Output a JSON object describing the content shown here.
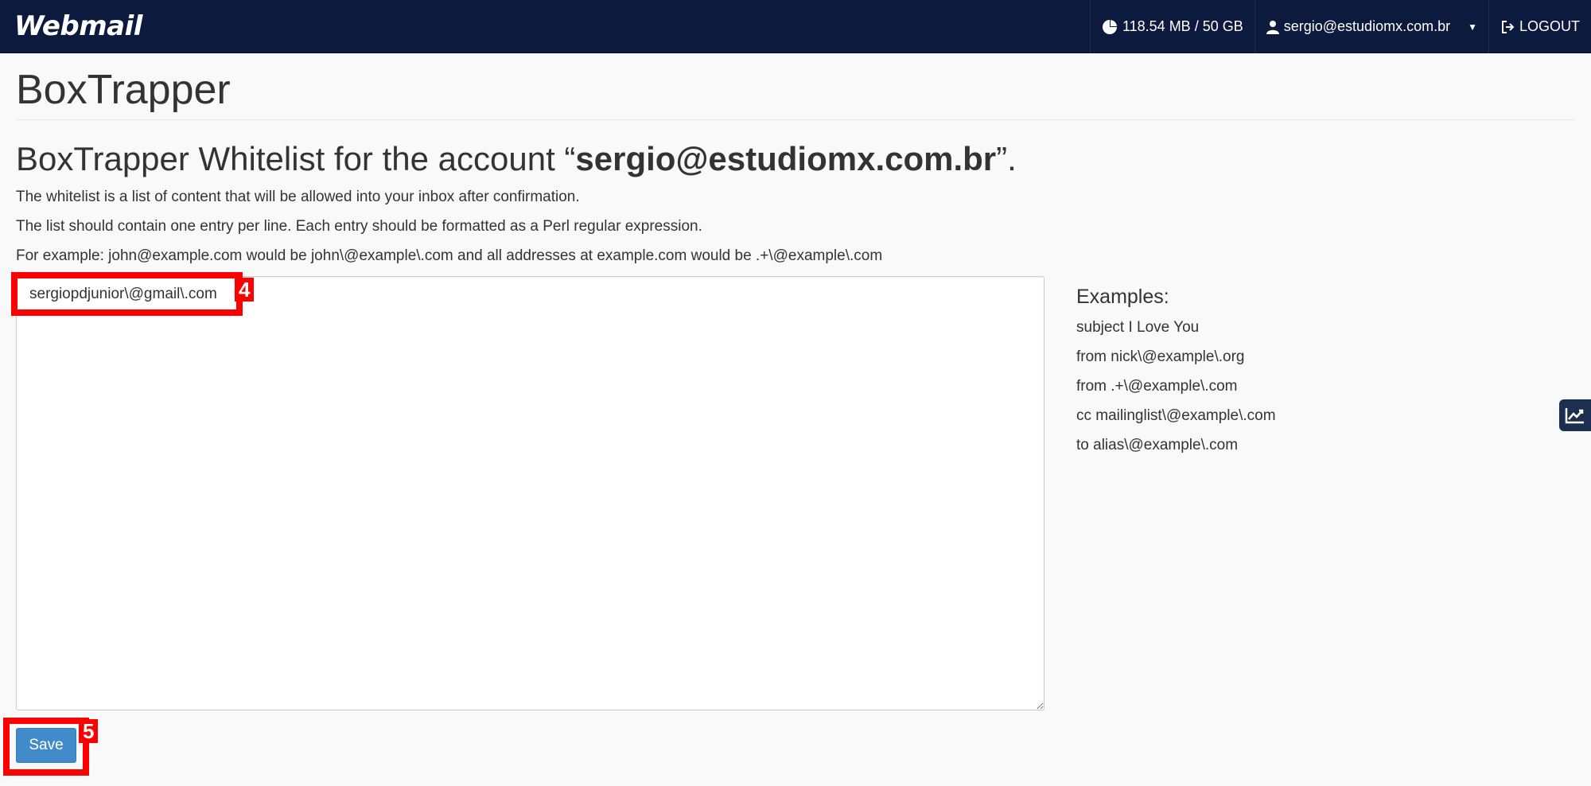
{
  "topbar": {
    "brand": "Webmail",
    "quota": "118.54 MB / 50 GB",
    "account": "sergio@estudiomx.com.br",
    "logout": "LOGOUT"
  },
  "page": {
    "title": "BoxTrapper",
    "heading_prefix": "BoxTrapper Whitelist for the account “",
    "heading_account": "sergio@estudiomx.com.br",
    "heading_suffix": "”.",
    "desc1": "The whitelist is a list of content that will be allowed into your inbox after confirmation.",
    "desc2": "The list should contain one entry per line. Each entry should be formatted as a Perl regular expression.",
    "desc3": "For example: john@example.com would be john\\@example\\.com and all addresses at example.com would be .+\\@example\\.com"
  },
  "whitelist": {
    "value": "sergiopdjunior\\@gmail\\.com"
  },
  "save_label": "Save",
  "examples": {
    "title": "Examples:",
    "items": [
      "subject I Love You",
      "from nick\\@example\\.org",
      "from .+\\@example\\.com",
      "cc mailinglist\\@example\\.com",
      "to alias\\@example\\.com"
    ]
  },
  "annotations": [
    "4",
    "5"
  ],
  "colors": {
    "topbar": "#0b1a3d",
    "primary_button": "#428bca",
    "annotation": "#ff0000"
  }
}
